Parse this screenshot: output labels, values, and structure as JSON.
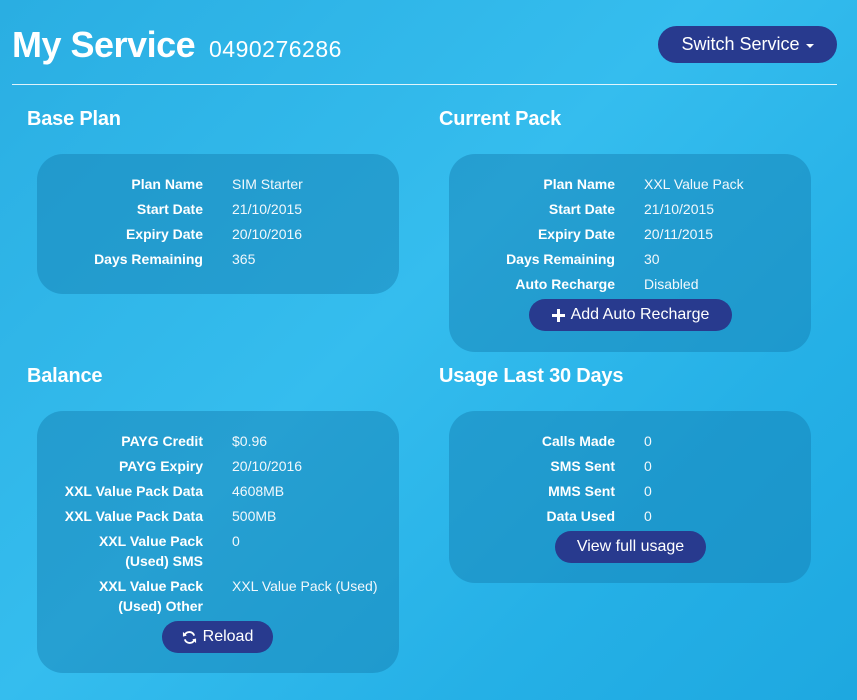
{
  "header": {
    "title": "My Service",
    "phone": "0490276286",
    "switch_label": "Switch Service"
  },
  "base_plan": {
    "title": "Base Plan",
    "rows": [
      {
        "label": "Plan Name",
        "value": "SIM Starter"
      },
      {
        "label": "Start Date",
        "value": "21/10/2015"
      },
      {
        "label": "Expiry Date",
        "value": "20/10/2016"
      },
      {
        "label": "Days Remaining",
        "value": "365"
      }
    ]
  },
  "current_pack": {
    "title": "Current Pack",
    "rows": [
      {
        "label": "Plan Name",
        "value": "XXL Value Pack"
      },
      {
        "label": "Start Date",
        "value": "21/10/2015"
      },
      {
        "label": "Expiry Date",
        "value": "20/11/2015"
      },
      {
        "label": "Days Remaining",
        "value": "30"
      },
      {
        "label": "Auto Recharge",
        "value": "Disabled"
      }
    ],
    "button_label": "Add Auto Recharge",
    "button_icon": "plus-icon"
  },
  "balance": {
    "title": "Balance",
    "rows": [
      {
        "label": "PAYG Credit",
        "value": "$0.96"
      },
      {
        "label": "PAYG Expiry",
        "value": "20/10/2016"
      },
      {
        "label": "XXL Value Pack Data",
        "value": "4608MB"
      },
      {
        "label": "XXL Value Pack Data",
        "value": "500MB"
      },
      {
        "label": "XXL Value Pack",
        "label2": "(Used) SMS",
        "value": "0"
      },
      {
        "label": "XXL Value Pack",
        "label2": "(Used) Other",
        "value": "XXL Value Pack (Used)"
      }
    ],
    "button_label": "Reload",
    "button_icon": "refresh-icon"
  },
  "usage": {
    "title": "Usage Last 30 Days",
    "rows": [
      {
        "label": "Calls Made",
        "value": "0"
      },
      {
        "label": "SMS Sent",
        "value": "0"
      },
      {
        "label": "MMS Sent",
        "value": "0"
      },
      {
        "label": "Data Used",
        "value": "0"
      }
    ],
    "button_label": "View full usage"
  },
  "colors": {
    "background": "#2aaee2",
    "card": "#147daf",
    "button": "#283a8e",
    "text": "#ffffff"
  }
}
